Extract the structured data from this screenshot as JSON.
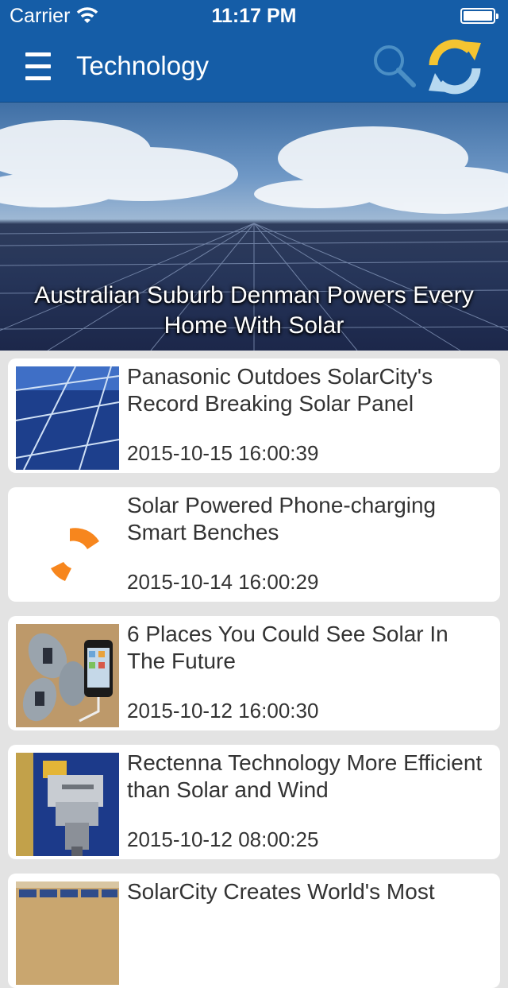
{
  "status_bar": {
    "carrier": "Carrier",
    "time": "11:17 PM"
  },
  "nav": {
    "title": "Technology"
  },
  "hero": {
    "title": "Australian Suburb Denman Powers Every Home With Solar"
  },
  "articles": [
    {
      "title": "Panasonic Outdoes SolarCity's Record Breaking Solar Panel",
      "date": "2015-10-15 16:00:39"
    },
    {
      "title": "Solar Powered Phone-charging Smart Benches",
      "date": "2015-10-14 16:00:29"
    },
    {
      "title": "6 Places You Could See Solar In The Future",
      "date": "2015-10-12 16:00:30"
    },
    {
      "title": "Rectenna Technology More Efficient than Solar and Wind",
      "date": "2015-10-12 08:00:25"
    },
    {
      "title": "SolarCity Creates World's Most",
      "date": ""
    }
  ],
  "colors": {
    "nav_background": "#155da7",
    "list_background": "#e3e3e3",
    "refresh_icon": "#f5c431",
    "logo_orange": "#f7861d"
  },
  "icons": {
    "menu": "menu-icon",
    "search": "search-icon",
    "refresh": "refresh-icon",
    "wifi": "wifi-icon",
    "battery": "battery-icon"
  }
}
